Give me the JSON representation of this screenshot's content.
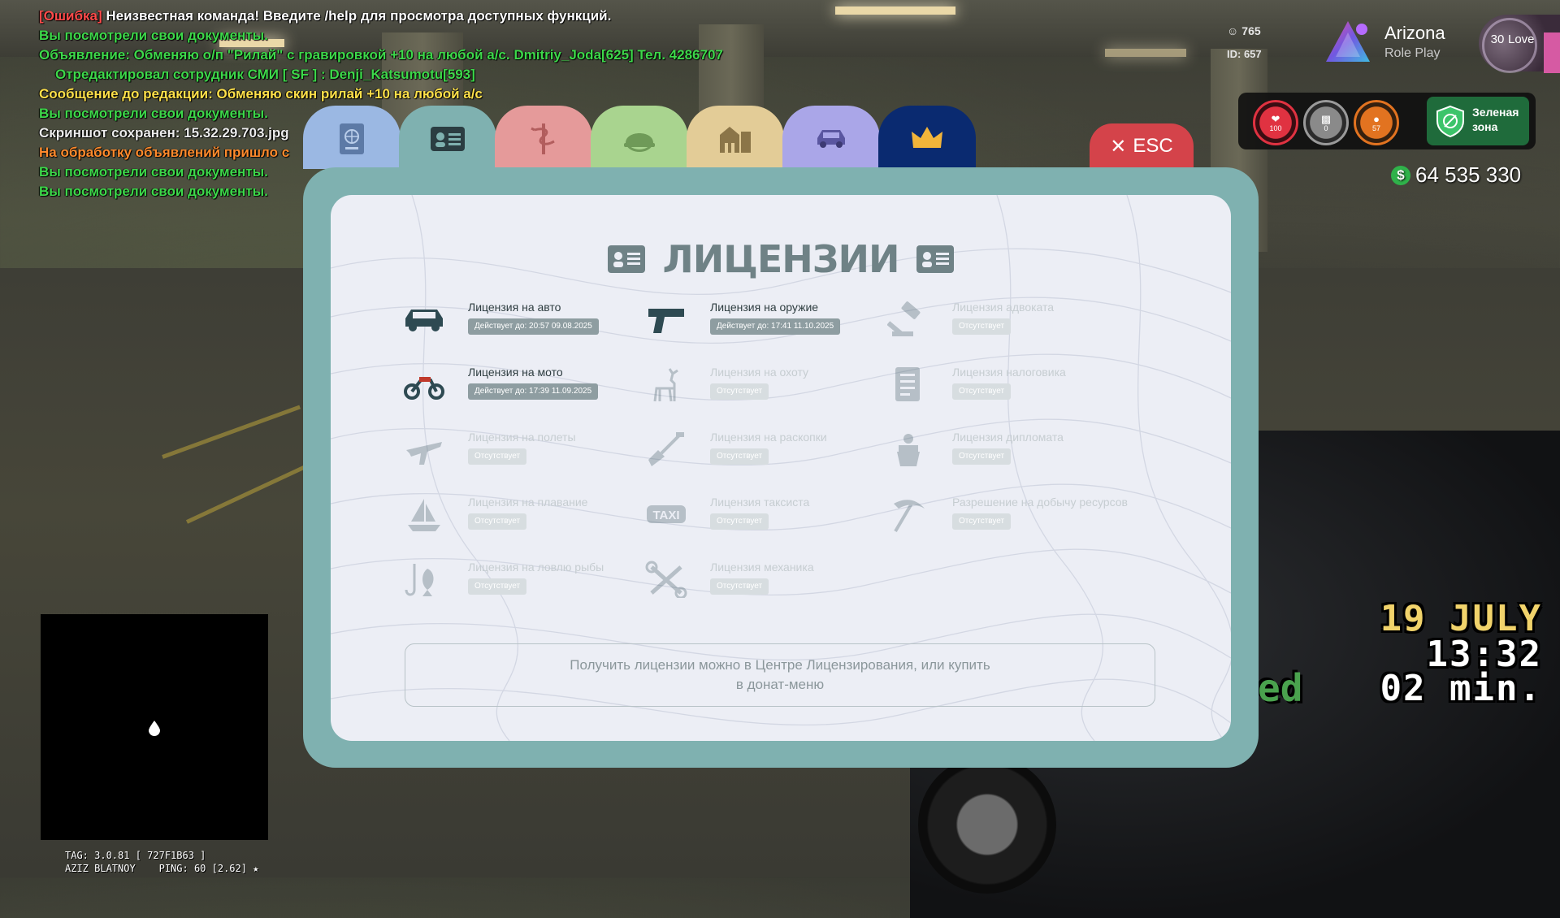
{
  "chat": {
    "line1_tag": "[Ошибка]",
    "line1_text": " Неизвестная команда! Введите /help для просмотра доступных функций.",
    "line2": "Вы посмотрели свои документы.",
    "line3": "Объявление: Обменяю о/п \"Рилай\" с гравировкой +10 на любой а/с. Dmitriy_Joda[625] Тел. 4286707",
    "line4": "Отредактировал сотрудник СМИ [ SF ] : Denji_Katsumotu[593]",
    "line5": "Сообщение до редакции: Обменяю скин рилай +10 на любой а/с",
    "line6": "Вы посмотрели свои документы.",
    "line7": "Скриншот сохранен: 15.32.29.703.jpg",
    "line8": "На обработку объявлений пришло с",
    "line9": "Вы посмотрели свои документы.",
    "line10": "Вы посмотрели свои документы."
  },
  "hud": {
    "online": "765",
    "id": "ID: 657",
    "brand_name": "Arizona",
    "brand_sub": "Role Play",
    "love_num": "30",
    "love_label": "Love",
    "hp": "100",
    "armor": "0",
    "hunger": "57",
    "zone_line1": "Зеленая",
    "zone_line2": "зона",
    "money": "64 535 330",
    "date": "19 JULY",
    "time": "13:32",
    "ed": "ed",
    "min": "02 min.",
    "tag_line1": "TAG: 3.0.81 [ 727F1B63 ]",
    "tag_line2": "AZIZ BLATNOY    PING: 60 [2.62] ★",
    "colors": {
      "hp": "#e03241",
      "armor": "#9a9a9a",
      "hunger": "#e27320",
      "zone": "#1f6b3b",
      "money": "#2fb24a"
    }
  },
  "tabs": [
    {
      "name": "passport",
      "icon": "passport-icon",
      "color": "#9bb8e3"
    },
    {
      "name": "licenses",
      "icon": "id-card-icon",
      "color": "#7fb1b0",
      "active": true
    },
    {
      "name": "medical",
      "icon": "medical-icon",
      "color": "#e59a9a"
    },
    {
      "name": "military",
      "icon": "helmet-icon",
      "color": "#a9d48f"
    },
    {
      "name": "property",
      "icon": "houses-icon",
      "color": "#e3cc97"
    },
    {
      "name": "vehicles",
      "icon": "car-icon",
      "color": "#aaa6e8"
    },
    {
      "name": "donate",
      "icon": "crown-icon",
      "color": "#0a2a70"
    }
  ],
  "esc_label": "ESC",
  "panel": {
    "title": "ЛИЦЕНЗИИ",
    "note": "Получить лицензии можно в Центре Лицензирования, или купить в донат-меню"
  },
  "licenses": [
    {
      "name": "Лицензия на авто",
      "status": "Действует до: 20:57 09.08.2025",
      "active": true,
      "icon": "car-icon"
    },
    {
      "name": "Лицензия на оружие",
      "status": "Действует до: 17:41 11.10.2025",
      "active": true,
      "icon": "pistol-icon"
    },
    {
      "name": "Лицензия адвоката",
      "status": "Отсутствует",
      "active": false,
      "icon": "gavel-icon"
    },
    {
      "name": "Лицензия на мото",
      "status": "Действует до: 17:39 11.09.2025",
      "active": true,
      "icon": "motorcycle-icon"
    },
    {
      "name": "Лицензия на охоту",
      "status": "Отсутствует",
      "active": false,
      "icon": "deer-icon"
    },
    {
      "name": "Лицензия налоговика",
      "status": "Отсутствует",
      "active": false,
      "icon": "tax-document-icon"
    },
    {
      "name": "Лицензия на полеты",
      "status": "Отсутствует",
      "active": false,
      "icon": "airplane-icon"
    },
    {
      "name": "Лицензия на раскопки",
      "status": "Отсутствует",
      "active": false,
      "icon": "shovel-icon"
    },
    {
      "name": "Лицензия дипломата",
      "status": "Отсутствует",
      "active": false,
      "icon": "diplomat-icon"
    },
    {
      "name": "Лицензия на плавание",
      "status": "Отсутствует",
      "active": false,
      "icon": "sailboat-icon"
    },
    {
      "name": "Лицензия таксиста",
      "status": "Отсутствует",
      "active": false,
      "icon": "taxi-icon"
    },
    {
      "name": "Разрешение на добычу ресурсов",
      "status": "Отсутствует",
      "active": false,
      "icon": "pickaxe-icon"
    },
    {
      "name": "Лицензия на ловлю рыбы",
      "status": "Отсутствует",
      "active": false,
      "icon": "fishing-icon"
    },
    {
      "name": "Лицензия механика",
      "status": "Отсутствует",
      "active": false,
      "icon": "wrench-icon"
    }
  ]
}
